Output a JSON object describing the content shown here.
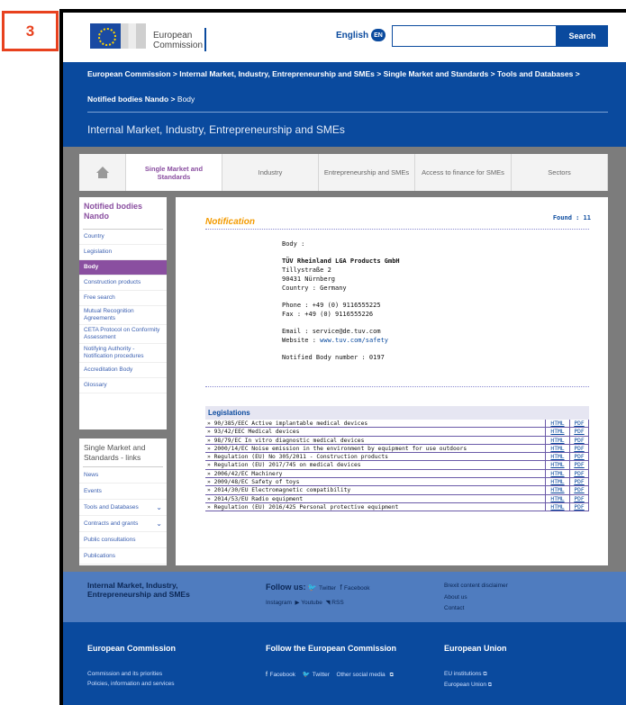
{
  "badge": "3",
  "header": {
    "logo_line1": "European",
    "logo_line2": "Commission",
    "language": "English",
    "language_code": "EN",
    "search_placeholder": "",
    "search_button": "Search"
  },
  "breadcrumb": {
    "line1": "European Commission > Internal Market, Industry, Entrepreneurship and SMEs > Single Market and Standards > Tools and Databases >",
    "line2_bold": "Notified bodies Nando >",
    "line2_current": "Body"
  },
  "site_title": "Internal Market, Industry, Entrepreneurship and SMEs",
  "nav": [
    {
      "label": "Single Market and Standards",
      "active": true
    },
    {
      "label": "Industry"
    },
    {
      "label": "Entrepreneurship and SMEs"
    },
    {
      "label": "Access to finance for SMEs"
    },
    {
      "label": "Sectors"
    }
  ],
  "sidebar": {
    "title": "Notified bodies Nando",
    "items": [
      "Country",
      "Legislation",
      "Body",
      "Construction products",
      "Free search",
      "Mutual Recognition Agreements",
      "CETA Protocol on Conformity Assessment",
      "Notifying Authority - Notification procedures",
      "Accreditation Body",
      "Glossary"
    ],
    "active_index": 2
  },
  "sidebar2": {
    "title": "Single Market and Standards - links",
    "items": [
      "News",
      "Events",
      "Tools and Databases",
      "Contracts and grants",
      "Public consultations",
      "Publications"
    ]
  },
  "notification": {
    "title": "Notification",
    "found": "Found : 11",
    "body_label": "Body :",
    "name": "TÜV Rheinland LGA Products GmbH",
    "street": "Tillystraße 2",
    "city": "90431 Nürnberg",
    "country": "Country : Germany",
    "phone": "Phone : +49 (0) 9116555225",
    "fax": "Fax : +49 (0) 9116555226",
    "email": "Email : service@de.tuv.com",
    "website_label": "Website :",
    "website": "www.tuv.com/safety",
    "nb_number": "Notified Body number : 0197"
  },
  "legislations": {
    "title": "Legislations",
    "html_label": "HTML",
    "pdf_label": "PDF",
    "rows": [
      "» 90/385/EEC Active implantable medical devices",
      "» 93/42/EEC Medical devices",
      "» 98/79/EC In vitro diagnostic medical devices",
      "» 2000/14/EC Noise emission in the environment by equipment for use outdoors",
      "» Regulation (EU) No 305/2011 - Construction products",
      "» Regulation (EU) 2017/745 on medical devices",
      "» 2006/42/EC Machinery",
      "» 2009/48/EC Safety of toys",
      "» 2014/30/EU Electromagnetic compatibility",
      "» 2014/53/EU Radio equipment",
      "» Regulation (EU) 2016/425 Personal protective equipment"
    ]
  },
  "footer1": {
    "title_line1": "Internal Market, Industry,",
    "title_line2": "Entrepreneurship and SMEs",
    "follow": "Follow us:",
    "twitter": "Twitter",
    "facebook": "Facebook",
    "instagram": "Instagram",
    "youtube": "Youtube",
    "rss": "RSS",
    "links": [
      "Brexit content disclaimer",
      "About us",
      "Contact"
    ]
  },
  "footer2": {
    "col1_title": "European Commission",
    "col1_links": [
      "Commission and its priorities",
      "Policies, information and services"
    ],
    "col2_title": "Follow the European Commission",
    "col2_facebook": "Facebook",
    "col2_twitter": "Twitter",
    "col2_other": "Other social media",
    "col3_title": "European Union",
    "col3_links": [
      "EU institutions",
      "European Union"
    ]
  }
}
